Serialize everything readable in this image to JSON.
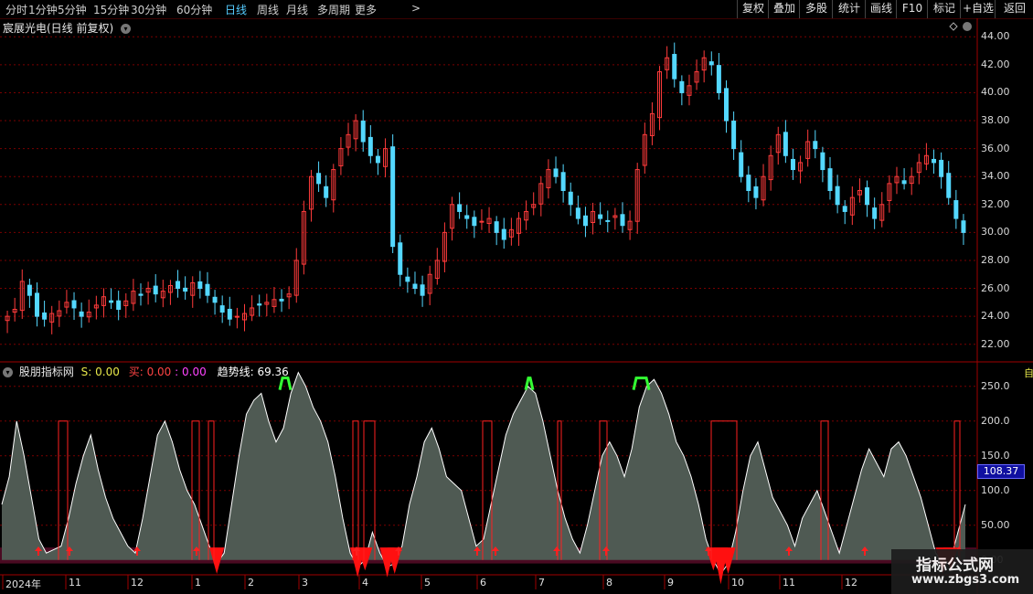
{
  "toolbar": {
    "periods": [
      "分时",
      "1分钟",
      "5分钟",
      "15分钟",
      "30分钟",
      "60分钟",
      "日线",
      "周线",
      "月线",
      "多周期",
      "更多"
    ],
    "active_period": "日线",
    "more_chevron": ">",
    "right_buttons": [
      "复权",
      "叠加",
      "多股",
      "统计",
      "画线",
      "F10",
      "标记",
      "+自选",
      "返回"
    ]
  },
  "stock": {
    "title": "宸展光电(日线 前复权)"
  },
  "indicator": {
    "name": "股朋指标网",
    "s_label": "S:",
    "s_value": "0.00",
    "buy_label": "买:",
    "buy_value": "0.00",
    "sep": ":",
    "third_value": "0.00",
    "trend_label": "趋势线:",
    "trend_value": "69.36",
    "current_badge": "108.37",
    "right_tab": "自"
  },
  "price_axis": [
    "44.00",
    "42.00",
    "40.00",
    "38.00",
    "36.00",
    "34.00",
    "32.00",
    "30.00",
    "28.00",
    "26.00",
    "24.00",
    "22.00"
  ],
  "indicator_axis": [
    "250.0",
    "200.0",
    "150.0",
    "100.0",
    "50.00",
    "0.00"
  ],
  "time_axis": [
    {
      "label": "2024年"
    },
    {
      "label": "11"
    },
    {
      "label": "12"
    },
    {
      "label": "1"
    },
    {
      "label": "2"
    },
    {
      "label": "3"
    },
    {
      "label": "4"
    },
    {
      "label": "5"
    },
    {
      "label": "6"
    },
    {
      "label": "7"
    },
    {
      "label": "8"
    },
    {
      "label": "9"
    },
    {
      "label": "10"
    },
    {
      "label": "11"
    },
    {
      "label": "12"
    }
  ],
  "watermark": {
    "line1": "指标公式网",
    "line2": "www.zbgs3.com"
  },
  "colors": {
    "up": "#ff3b3b",
    "down": "#54d8ff",
    "trend_fill": "#4f5a53",
    "band": "#4a0a22",
    "green": "#33ff33",
    "grid": "#7a0000",
    "active": "#55ccff",
    "yellow": "#e8e84a",
    "magenta": "#ff44ff"
  },
  "chart_data": {
    "type": "candlestick",
    "price_range": [
      21,
      45
    ],
    "indicator_range": [
      -20,
      280
    ],
    "close_series": [
      24.0,
      24.5,
      26.5,
      25.5,
      24.0,
      23.8,
      24.2,
      24.4,
      25.0,
      24.6,
      24.0,
      24.3,
      24.8,
      25.4,
      25.0,
      24.5,
      25.1,
      25.8,
      25.5,
      26.0,
      25.6,
      25.8,
      26.2,
      26.0,
      25.8,
      26.4,
      26.0,
      25.5,
      25.0,
      24.3,
      23.8,
      24.0,
      24.2,
      24.6,
      24.8,
      25.0,
      25.2,
      25.1,
      25.6,
      28.0,
      31.5,
      34.0,
      33.5,
      32.5,
      34.5,
      36.0,
      37.0,
      38.0,
      36.5,
      35.5,
      35.0,
      36.0,
      29.0,
      27.0,
      26.5,
      26.0,
      25.5,
      27.0,
      28.0,
      30.0,
      32.0,
      31.5,
      31.0,
      30.5,
      30.8,
      31.0,
      30.0,
      29.5,
      30.2,
      31.0,
      31.5,
      32.0,
      33.5,
      34.5,
      34.0,
      33.0,
      32.0,
      31.0,
      30.5,
      31.5,
      31.0,
      30.8,
      31.2,
      30.5,
      30.8,
      34.5,
      37.0,
      38.5,
      41.5,
      42.5,
      41.0,
      40.0,
      40.5,
      41.5,
      42.5,
      42.0,
      40.0,
      38.0,
      36.0,
      34.0,
      33.0,
      32.5,
      34.0,
      35.5,
      37.0,
      35.5,
      34.5,
      35.0,
      36.5,
      36.0,
      34.5,
      33.0,
      32.0,
      31.5,
      32.5,
      33.0,
      32.0,
      31.0,
      32.0,
      33.5,
      34.0,
      33.5,
      34.0,
      35.0,
      35.5,
      35.0,
      34.0,
      32.5,
      31.0,
      30.0
    ],
    "trend_series": [
      80,
      120,
      200,
      150,
      90,
      30,
      10,
      15,
      20,
      60,
      110,
      150,
      180,
      130,
      90,
      60,
      40,
      20,
      10,
      60,
      120,
      180,
      200,
      170,
      130,
      100,
      80,
      50,
      20,
      -5,
      10,
      80,
      150,
      210,
      230,
      240,
      200,
      170,
      190,
      240,
      270,
      250,
      220,
      200,
      170,
      120,
      60,
      10,
      -10,
      0,
      40,
      10,
      -10,
      -5,
      20,
      80,
      120,
      170,
      190,
      160,
      120,
      110,
      100,
      60,
      20,
      30,
      80,
      130,
      180,
      210,
      230,
      250,
      240,
      200,
      150,
      100,
      60,
      30,
      10,
      50,
      100,
      150,
      170,
      150,
      120,
      160,
      220,
      250,
      260,
      240,
      210,
      170,
      150,
      120,
      80,
      30,
      0,
      -20,
      -5,
      40,
      100,
      150,
      170,
      130,
      90,
      70,
      50,
      20,
      60,
      80,
      100,
      70,
      40,
      10,
      50,
      90,
      130,
      160,
      140,
      120,
      160,
      170,
      150,
      120,
      90,
      50,
      10,
      -5,
      0,
      40,
      80
    ]
  }
}
